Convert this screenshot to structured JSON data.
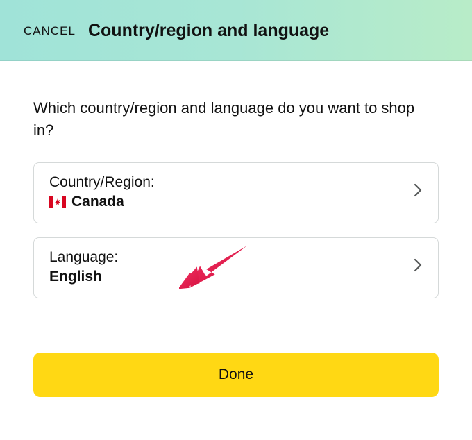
{
  "header": {
    "cancel_label": "CANCEL",
    "title": "Country/region and language"
  },
  "main": {
    "question": "Which country/region and language do you want to shop in?",
    "country_row": {
      "label": "Country/Region:",
      "value": "Canada",
      "flag": "canada-flag"
    },
    "language_row": {
      "label": "Language:",
      "value": "English"
    },
    "done_label": "Done"
  },
  "colors": {
    "header_gradient_start": "#a0e3d8",
    "header_gradient_end": "#b8ecc8",
    "done_button": "#ffd814",
    "border": "#d5d9d9",
    "annotation_arrow": "#e61a52"
  }
}
